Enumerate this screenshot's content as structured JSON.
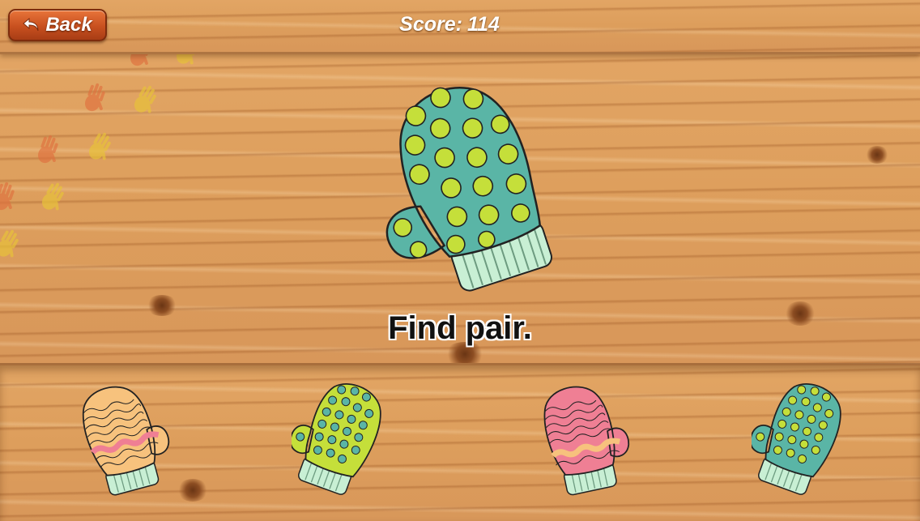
{
  "header": {
    "back_label": "Back",
    "score_label": "Score:",
    "score_value": "114"
  },
  "prompt": "Find pair.",
  "colors": {
    "wood": "#dd9e5c",
    "back_button": "#c8501f",
    "teal": "#5ab5a6",
    "lime": "#c5df3a",
    "mint": "#c8efd4",
    "peach": "#f7c27d",
    "pink": "#ef7f94"
  },
  "target": {
    "pattern": "dots",
    "body_color": "teal",
    "dot_color": "lime",
    "cuff_color": "mint"
  },
  "choices": [
    {
      "pattern": "waves",
      "body_color": "peach",
      "stripe_color": "pink",
      "cuff_color": "mint"
    },
    {
      "pattern": "dots",
      "body_color": "lime",
      "dot_color": "teal",
      "cuff_color": "mint"
    },
    {
      "pattern": "waves",
      "body_color": "pink",
      "stripe_color": "peach",
      "cuff_color": "mint"
    },
    {
      "pattern": "dots",
      "body_color": "teal",
      "dot_color": "lime",
      "cuff_color": "mint"
    }
  ]
}
